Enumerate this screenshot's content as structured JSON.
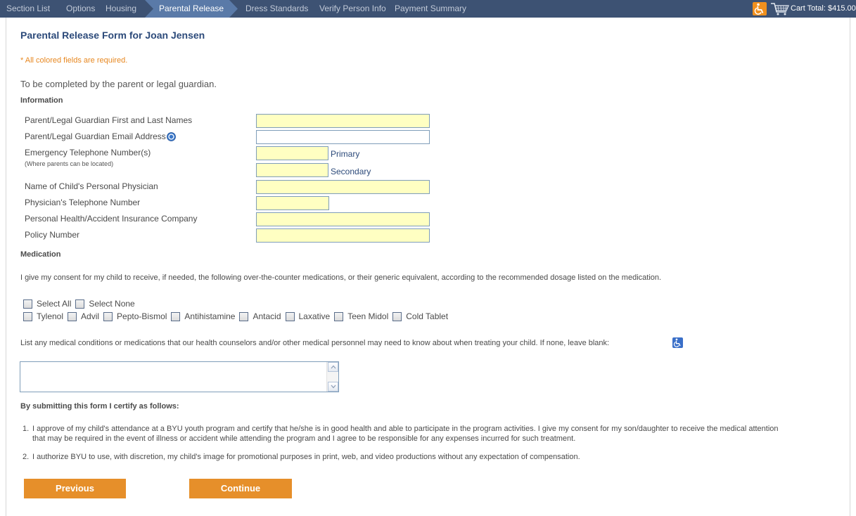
{
  "nav": {
    "items": [
      "Section List",
      "Options",
      "Housing",
      "Parental Release",
      "Dress Standards",
      "Verify Person Info",
      "Payment Summary"
    ],
    "active": "Parental Release",
    "cart_total": "Cart Total: $415.00",
    "colors": {
      "bar": "#3d5273",
      "active": "#5a7aa8",
      "accent": "#f0901e"
    }
  },
  "page": {
    "title": "Parental Release Form for Joan Jensen",
    "required_note": "* All colored fields are required.",
    "intro": "To be completed by the parent or legal guardian."
  },
  "information": {
    "heading": "Information",
    "fields": {
      "guardian_names": {
        "label": "Parent/Legal Guardian First and Last Names",
        "value": ""
      },
      "guardian_email": {
        "label": "Parent/Legal Guardian Email Address",
        "value": ""
      },
      "emergency_phone": {
        "label": "Emergency Telephone Number(s)",
        "sublabel": "(Where parents can be located)",
        "primary_label": "Primary",
        "secondary_label": "Secondary",
        "primary_value": "",
        "secondary_value": ""
      },
      "physician_name": {
        "label": "Name of Child's Personal Physician",
        "value": ""
      },
      "physician_phone": {
        "label": "Physician's Telephone Number",
        "value": ""
      },
      "insurance_company": {
        "label": "Personal Health/Accident Insurance Company",
        "value": ""
      },
      "policy_number": {
        "label": "Policy Number",
        "value": ""
      }
    }
  },
  "medication": {
    "heading": "Medication",
    "consent": "I give my consent for my child to receive, if needed, the following over-the-counter medications, or their generic equivalent, according to the recommended dosage listed on the medication.",
    "select_all": "Select All",
    "select_none": "Select None",
    "options": [
      "Tylenol",
      "Advil",
      "Pepto-Bismol",
      "Antihistamine",
      "Antacid",
      "Laxative",
      "Teen Midol",
      "Cold Tablet"
    ],
    "conditions_prompt": "List any medical conditions or medications that our health counselors and/or other medical personnel may need to know about when treating your child. If none, leave blank:",
    "conditions_value": ""
  },
  "certify": {
    "heading": "By submitting this form I certify as follows:",
    "items": [
      {
        "num": "1.",
        "line1": "I approve of my child's attendance at a BYU youth program and certify that he/she is in good health and able to participate in the program activities. I give my consent for my son/daughter to receive the medical attention",
        "line2": "that may be required in the event of illness or accident while attending the program and I agree to be responsible for any expenses incurred for such treatment."
      },
      {
        "num": "2.",
        "line1": "I authorize BYU to use, with discretion, my child's image for promotional purposes in print, web, and video productions without any expectation of compensation."
      }
    ]
  },
  "buttons": {
    "previous": "Previous",
    "continue": "Continue"
  }
}
